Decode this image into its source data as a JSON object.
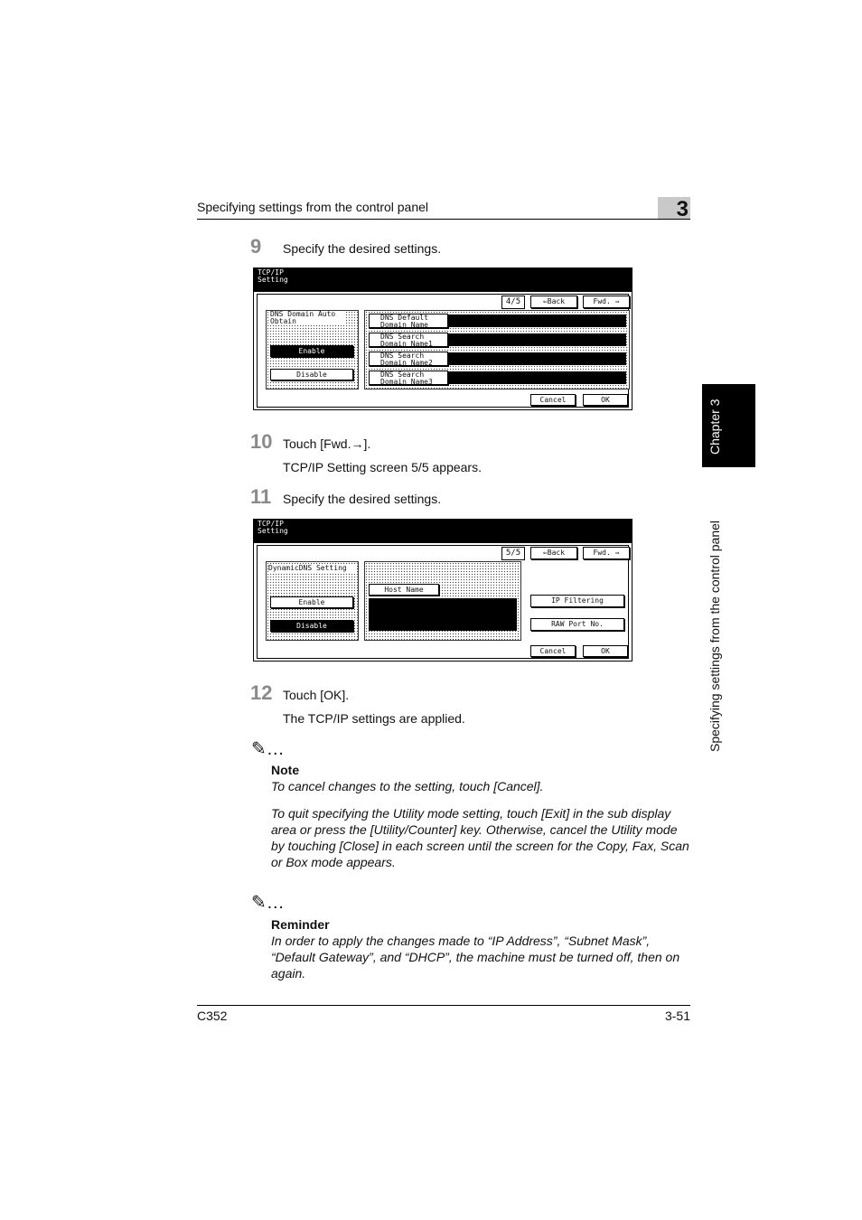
{
  "header": {
    "title": "Specifying settings from the control panel",
    "chapter_number": "3"
  },
  "side_tab": {
    "chapter_label": "Chapter 3",
    "running_title": "Specifying settings from the control panel"
  },
  "steps": [
    {
      "num": "9",
      "text": "Specify the desired settings."
    },
    {
      "num": "10",
      "text": "Touch [Fwd.→].",
      "result": "TCP/IP Setting screen 5/5 appears."
    },
    {
      "num": "11",
      "text": "Specify the desired settings."
    },
    {
      "num": "12",
      "text": "Touch [OK].",
      "result": "The TCP/IP settings are applied."
    }
  ],
  "panel1": {
    "title": "TCP/IP Setting",
    "page": "4/5",
    "back": "⇐Back",
    "fwd": "Fwd. ⇒",
    "group_title": "DNS Domain Auto Obtain",
    "enable": "Enable",
    "disable": "Disable",
    "fields": [
      "DNS Default Domain Name",
      "DNS Search Domain Name1",
      "DNS Search Domain Name2",
      "DNS Search Domain Name3"
    ],
    "cancel": "Cancel",
    "ok": "OK"
  },
  "panel2": {
    "title": "TCP/IP Setting",
    "page": "5/5",
    "back": "⇐Back",
    "fwd": "Fwd. ⇒",
    "group_title": "DynamicDNS Setting",
    "enable": "Enable",
    "disable": "Disable",
    "host_name": "Host Name",
    "ip_filtering": "IP Filtering",
    "raw_port": "RAW Port No.",
    "cancel": "Cancel",
    "ok": "OK"
  },
  "note": {
    "icon": "✎…",
    "heading": "Note",
    "para1": "To cancel changes to the setting, touch [Cancel].",
    "para2": "To quit specifying the Utility mode setting, touch [Exit] in the sub display area or press the [Utility/Counter] key. Otherwise, cancel the Utility mode by touching [Close] in each screen until the screen for the Copy, Fax, Scan or Box mode appears."
  },
  "reminder": {
    "icon": "✎…",
    "heading": "Reminder",
    "text": "In order to apply the changes made to “IP Address”, “Subnet Mask”, “Default Gateway”, and “DHCP”, the machine must be turned off, then on again."
  },
  "footer": {
    "model": "C352",
    "page": "3-51"
  }
}
